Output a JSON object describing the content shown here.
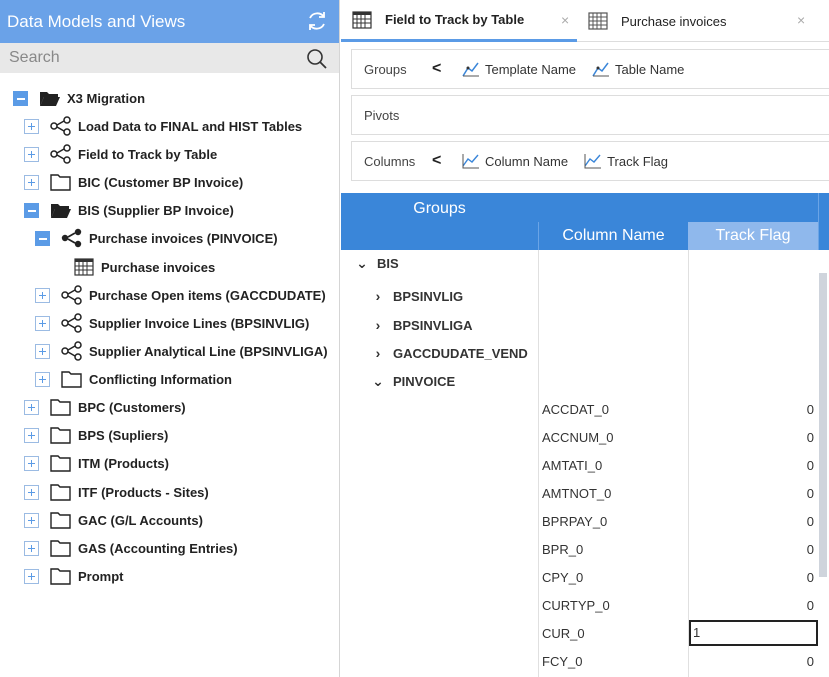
{
  "left_panel": {
    "title": "Data Models and Views",
    "search_placeholder": "Search",
    "tree": [
      {
        "label": "X3 Migration"
      },
      {
        "label": "Load Data to FINAL and HIST Tables"
      },
      {
        "label": "Field to Track by Table"
      },
      {
        "label": "BIC (Customer BP Invoice)"
      },
      {
        "label": "BIS (Supplier BP Invoice)"
      },
      {
        "label": "Purchase invoices (PINVOICE)"
      },
      {
        "label": "Purchase invoices"
      },
      {
        "label": "Purchase Open items (GACCDUDATE)"
      },
      {
        "label": "Supplier Invoice Lines (BPSINVLIG)"
      },
      {
        "label": "Supplier Analytical Line (BPSINVLIGA)"
      },
      {
        "label": "Conflicting Information"
      },
      {
        "label": "BPC (Customers)"
      },
      {
        "label": "BPS (Supliers)"
      },
      {
        "label": "ITM (Products)"
      },
      {
        "label": "ITF (Products - Sites)"
      },
      {
        "label": "GAC (G/L Accounts)"
      },
      {
        "label": "GAS (Accounting Entries)"
      },
      {
        "label": "Prompt"
      }
    ]
  },
  "tabs": [
    {
      "label": "Field to Track by Table",
      "close": "×"
    },
    {
      "label": "Purchase invoices",
      "close": "×"
    }
  ],
  "zones": {
    "groups": {
      "title": "Groups",
      "chevron": "<",
      "chips": [
        "Template Name",
        "Table Name"
      ]
    },
    "pivots": {
      "title": "Pivots"
    },
    "columns": {
      "title": "Columns",
      "chevron": "<",
      "chips": [
        "Column Name",
        "Track Flag"
      ]
    }
  },
  "grid": {
    "groups_header": "Groups",
    "column_name_header": "Column Name",
    "track_flag_header": "Track Flag",
    "groups": [
      {
        "label": "BIS",
        "expanded": true
      },
      {
        "label": "BPSINVLIG",
        "expanded": false
      },
      {
        "label": "BPSINVLIGA",
        "expanded": false
      },
      {
        "label": "GACCDUDATE_VEND",
        "expanded": false
      },
      {
        "label": "PINVOICE",
        "expanded": true
      }
    ],
    "rows": [
      {
        "name": "ACCDAT_0",
        "value": "0"
      },
      {
        "name": "ACCNUM_0",
        "value": "0"
      },
      {
        "name": "AMTATI_0",
        "value": "0"
      },
      {
        "name": "AMTNOT_0",
        "value": "0"
      },
      {
        "name": "BPRPAY_0",
        "value": "0"
      },
      {
        "name": "BPR_0",
        "value": "0"
      },
      {
        "name": "CPY_0",
        "value": "0"
      },
      {
        "name": "CURTYP_0",
        "value": "0"
      },
      {
        "name": "CUR_0",
        "value": "1"
      },
      {
        "name": "FCY_0",
        "value": "0"
      }
    ]
  },
  "colors": {
    "header_blue": "#6aa2e8",
    "grid_blue": "#3a86d9",
    "active_col": "#8fb8ec"
  }
}
